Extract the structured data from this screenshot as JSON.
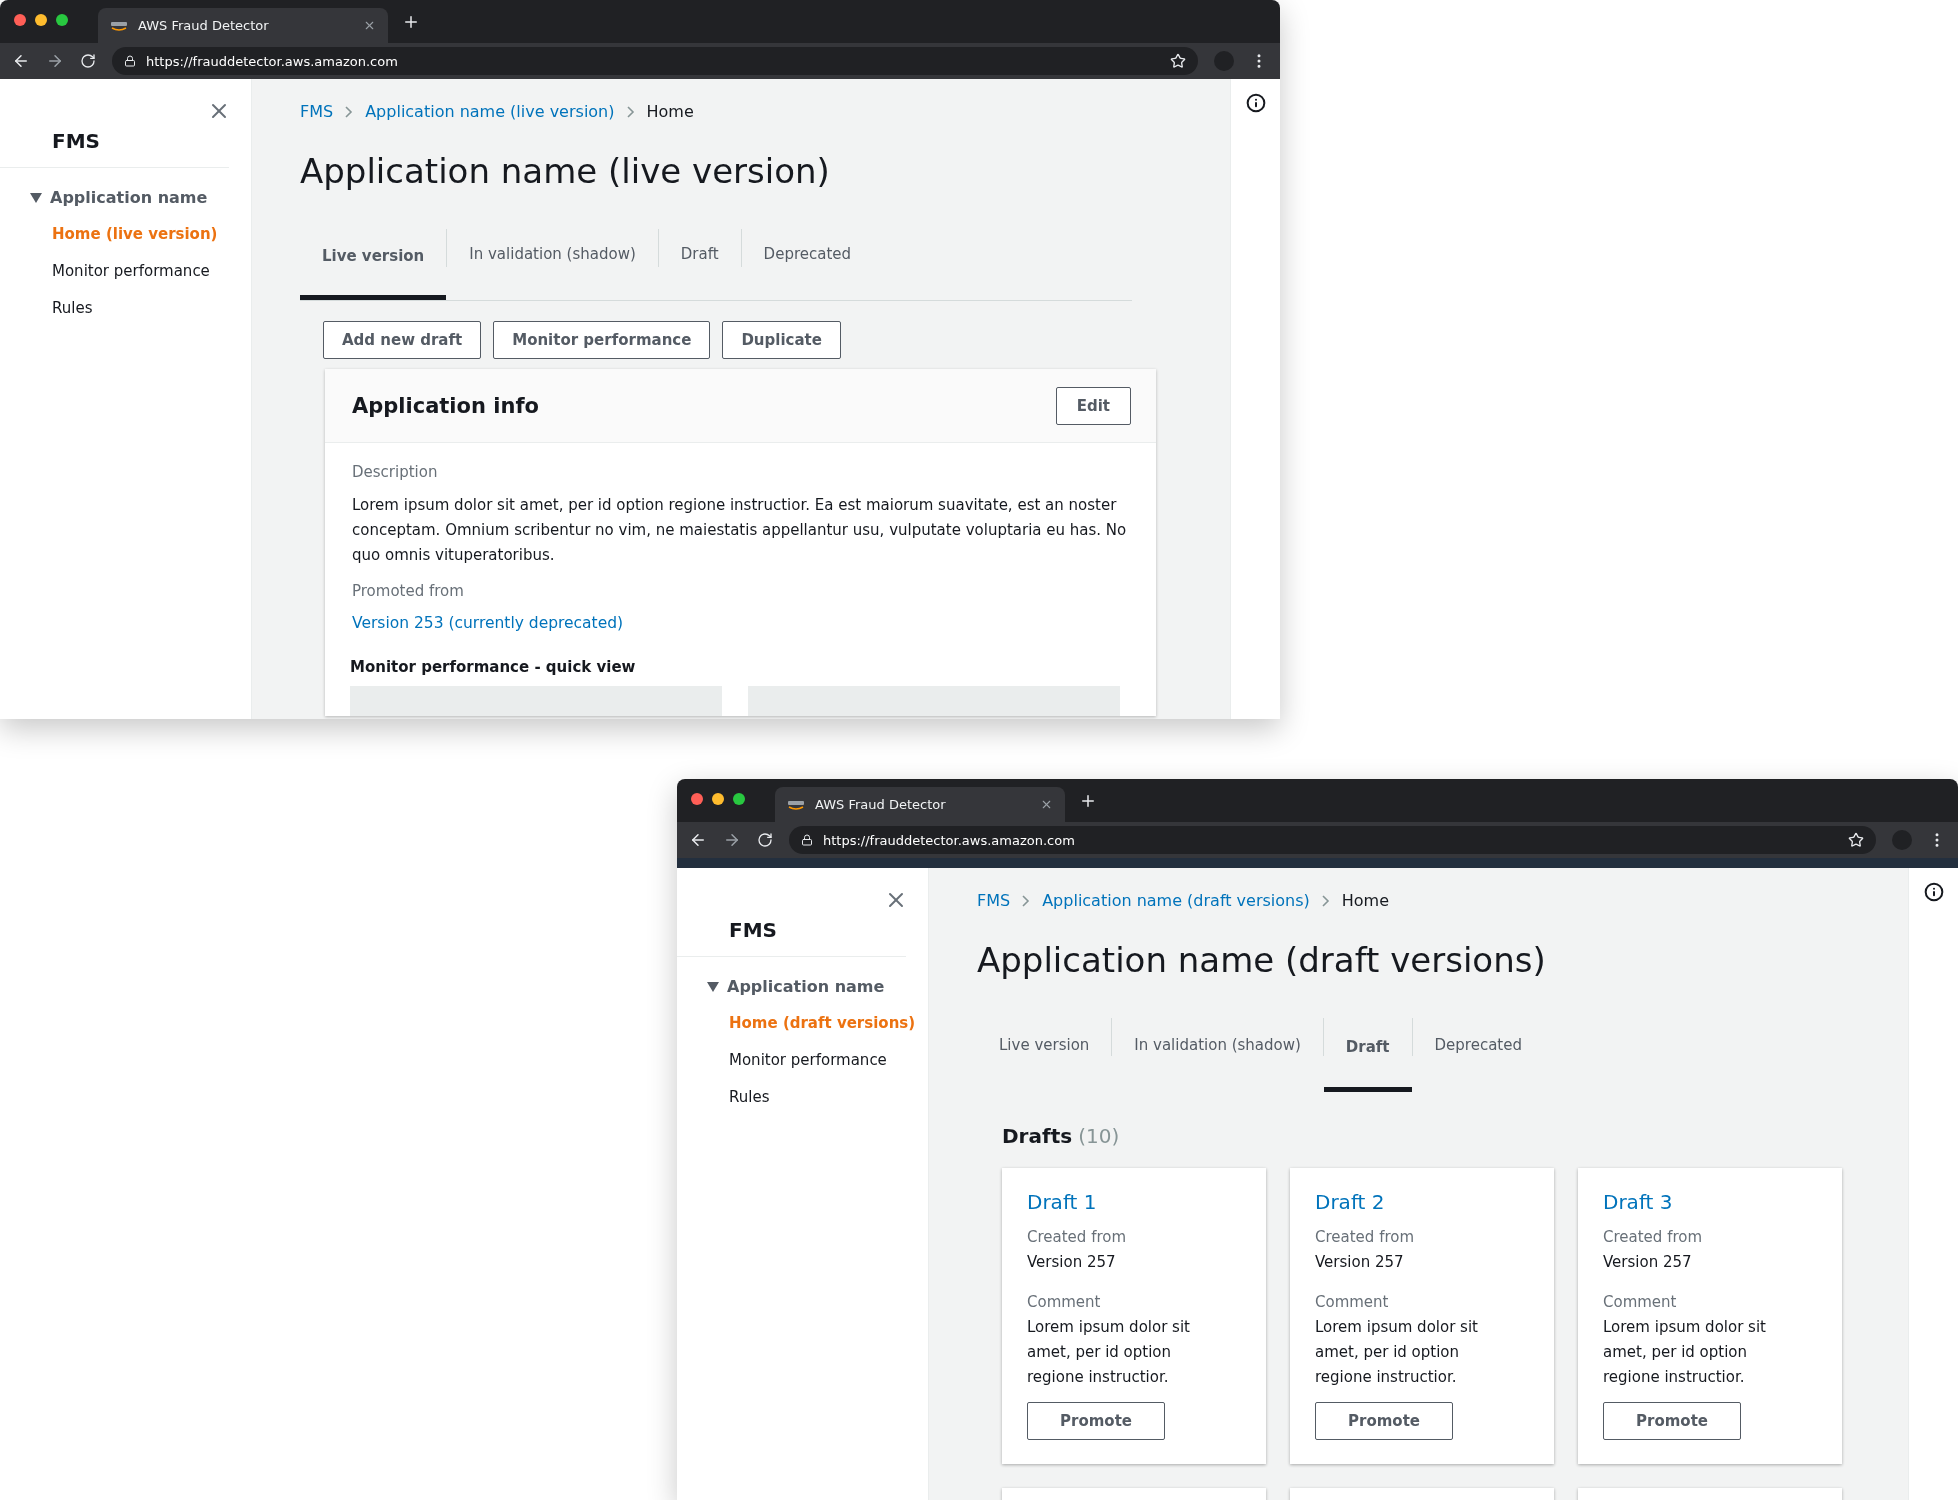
{
  "windows": [
    {
      "kind": "live",
      "nav_strip": false,
      "browser": {
        "tab_title": "AWS Fraud Detector",
        "url": "https://frauddetector.aws.amazon.com"
      },
      "sidebar": {
        "title": "FMS",
        "section": "Application name",
        "items": [
          {
            "label": "Home (live version)",
            "selected": true
          },
          {
            "label": "Monitor performance",
            "selected": false
          },
          {
            "label": "Rules",
            "selected": false
          }
        ]
      },
      "breadcrumbs": [
        "FMS",
        "Application name (live version)",
        "Home"
      ],
      "title": "Application name (live version)",
      "tabs": [
        {
          "label": "Live version",
          "selected": true
        },
        {
          "label": "In validation (shadow)",
          "selected": false
        },
        {
          "label": "Draft",
          "selected": false
        },
        {
          "label": "Deprecated",
          "selected": false
        }
      ],
      "buttons": [
        "Add new draft",
        "Monitor performance",
        "Duplicate"
      ],
      "info_card": {
        "title": "Application info",
        "edit_button": "Edit",
        "description_label": "Description",
        "description": "Lorem ipsum dolor sit amet, per id option regione instructior. Ea est maiorum suavitate, est an noster conceptam. Omnium scribentur no vim, ne maiestatis appellantur usu, vulputate voluptaria eu has. No quo omnis vituperatoribus.",
        "promoted_label": "Promoted from",
        "promoted_link": "Version 253 (currently deprecated)",
        "quick_view_title": "Monitor performance - quick view"
      }
    },
    {
      "kind": "drafts",
      "nav_strip": true,
      "browser": {
        "tab_title": "AWS Fraud Detector",
        "url": "https://frauddetector.aws.amazon.com"
      },
      "sidebar": {
        "title": "FMS",
        "section": "Application name",
        "items": [
          {
            "label": "Home (draft versions)",
            "selected": true
          },
          {
            "label": "Monitor performance",
            "selected": false
          },
          {
            "label": "Rules",
            "selected": false
          }
        ]
      },
      "breadcrumbs": [
        "FMS",
        "Application name (draft versions)",
        "Home"
      ],
      "title": "Application name (draft versions)",
      "tabs": [
        {
          "label": "Live version",
          "selected": false
        },
        {
          "label": "In validation (shadow)",
          "selected": false
        },
        {
          "label": "Draft",
          "selected": true
        },
        {
          "label": "Deprecated",
          "selected": false
        }
      ],
      "drafts": {
        "title": "Drafts",
        "count": "(10)",
        "cards": [
          {
            "title": "Draft 1",
            "created_label": "Created from",
            "created_value": "Version 257",
            "comment_label": "Comment",
            "comment": "Lorem ipsum dolor sit amet, per id option regione instructior.",
            "button": "Promote"
          },
          {
            "title": "Draft 2",
            "created_label": "Created from",
            "created_value": "Version 257",
            "comment_label": "Comment",
            "comment": "Lorem ipsum dolor sit amet, per id option regione instructior.",
            "button": "Promote"
          },
          {
            "title": "Draft 3",
            "created_label": "Created from",
            "created_value": "Version 257",
            "comment_label": "Comment",
            "comment": "Lorem ipsum dolor sit amet, per id option regione instructior.",
            "button": "Promote"
          }
        ]
      }
    }
  ]
}
